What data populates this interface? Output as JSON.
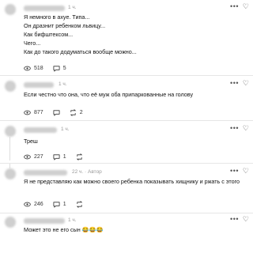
{
  "comments": [
    {
      "time": "1 ч.",
      "lines": "Я немного в ахуе. Типа...\nОн дразнит ребенком львицу...\nКак бифштексом...\nЧего...\nКак до такого додуматься вообще можно...",
      "views": "518",
      "replies": "5",
      "reposts": "",
      "is_author": false
    },
    {
      "time": "1 ч.",
      "lines": "Если честно что она, что её муж оба припаркованные на голову",
      "views": "877",
      "replies": "",
      "reposts": "2",
      "is_author": false
    },
    {
      "time": "1 ч.",
      "lines": "Треш",
      "views": "227",
      "replies": "1",
      "reposts": "",
      "is_author": false
    },
    {
      "time": "22 ч.",
      "author_label": "· Автор",
      "lines": "Я не представляю как можно своего ребенка показывать хищнику и ржать с этого",
      "views": "246",
      "replies": "1",
      "reposts": "",
      "is_author": true
    },
    {
      "time": "1 ч.",
      "lines": "Может это не его сын 😂😂😂",
      "views": "",
      "replies": "",
      "reposts": "",
      "is_author": false
    }
  ],
  "icons": {
    "more": "more-dots-icon",
    "like": "heart-icon",
    "views": "eye-icon",
    "reply": "reply-icon",
    "repost": "repost-icon"
  }
}
